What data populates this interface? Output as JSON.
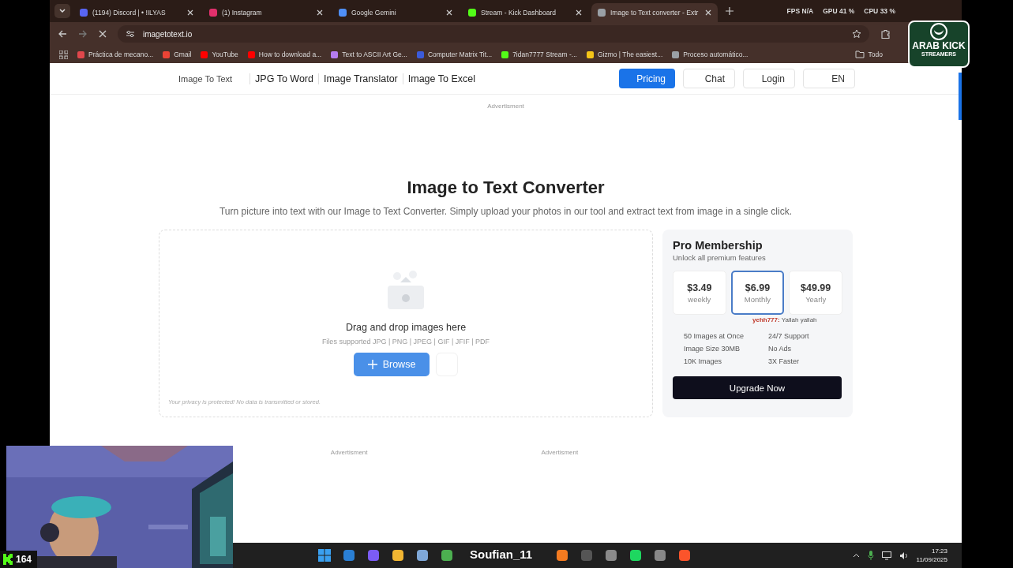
{
  "browser": {
    "tabs": [
      {
        "title": "(1194) Discord | • !ILYAS",
        "selected": false,
        "color": "#5865f2"
      },
      {
        "title": "(1) Instagram",
        "selected": false,
        "color": "#e1306c"
      },
      {
        "title": "Google Gemini",
        "selected": false,
        "color": "#4f8ff7"
      },
      {
        "title": "Stream - Kick Dashboard",
        "selected": false,
        "color": "#53fc18"
      },
      {
        "title": "Image to Text converter - Extr",
        "selected": true,
        "color": "#9aa0a6"
      }
    ],
    "url": "imagetotext.io",
    "bookmarks": [
      {
        "title": "Práctica de mecano...",
        "color": "#e0474c"
      },
      {
        "title": "Gmail",
        "color": "#ea4335"
      },
      {
        "title": "YouTube",
        "color": "#ff0000"
      },
      {
        "title": "How to download a...",
        "color": "#ff0000"
      },
      {
        "title": "Text to ASCII Art Ge...",
        "color": "#b57cf0"
      },
      {
        "title": "Computer Matrix Tit...",
        "color": "#3b5bdb"
      },
      {
        "title": "7idan7777 Stream -...",
        "color": "#53fc18"
      },
      {
        "title": "Gizmo | The easiest...",
        "color": "#f5c518"
      },
      {
        "title": "Proceso automático...",
        "color": "#9aa0a6"
      }
    ],
    "folder": "Todo"
  },
  "stats": [
    {
      "label": "FPS",
      "value": "N/A"
    },
    {
      "label": "GPU",
      "value": "41 %"
    },
    {
      "label": "CPU",
      "value": "33 %"
    }
  ],
  "nav": {
    "links": [
      "Image To Text",
      "JPG To Word",
      "Image Translator",
      "Image To Excel"
    ],
    "buttons": [
      {
        "label": "Pricing",
        "kind": "primary"
      },
      {
        "label": "Chat",
        "kind": "plain"
      },
      {
        "label": "Login",
        "kind": "plain"
      },
      {
        "label": "EN",
        "kind": "plain"
      }
    ]
  },
  "ad_top": "Advertisment",
  "hero": {
    "title": "Image to Text Converter",
    "subtitle": "Turn picture into text with our Image to Text Converter. Simply upload your photos in our tool and extract text from image in a single click."
  },
  "upload": {
    "prompt": "Drag and drop images here",
    "formats": "Files supported JPG | PNG | JPEG | GIF | JFIF | PDF",
    "button": "Browse",
    "privacy": "Your privacy is protected! No data is transmitted or stored."
  },
  "pro": {
    "title": "Pro Membership",
    "subtitle": "Unlock all premium features",
    "plans": [
      {
        "price": "$3.49",
        "period": "weekly",
        "selected": false
      },
      {
        "price": "$6.99",
        "period": "Monthly",
        "selected": true
      },
      {
        "price": "$49.99",
        "period": "Yearly",
        "selected": false
      }
    ],
    "features": [
      "50 Images at Once",
      "24/7 Support",
      "Image Size 30MB",
      "No Ads",
      "10K Images",
      "3X Faster"
    ],
    "button": "Upgrade Now"
  },
  "ads_bottom": [
    "Advertisment",
    "Advertisment"
  ],
  "taskbar": {
    "time": "17:23",
    "date": "11/09/2025"
  },
  "overlay": {
    "logo": [
      "ARAB KICK",
      "STREAMERS"
    ],
    "viewers": "164",
    "chat_user": "yehh777:",
    "chat_text": "Yallah yallah",
    "streamer": "Soufian_11"
  }
}
